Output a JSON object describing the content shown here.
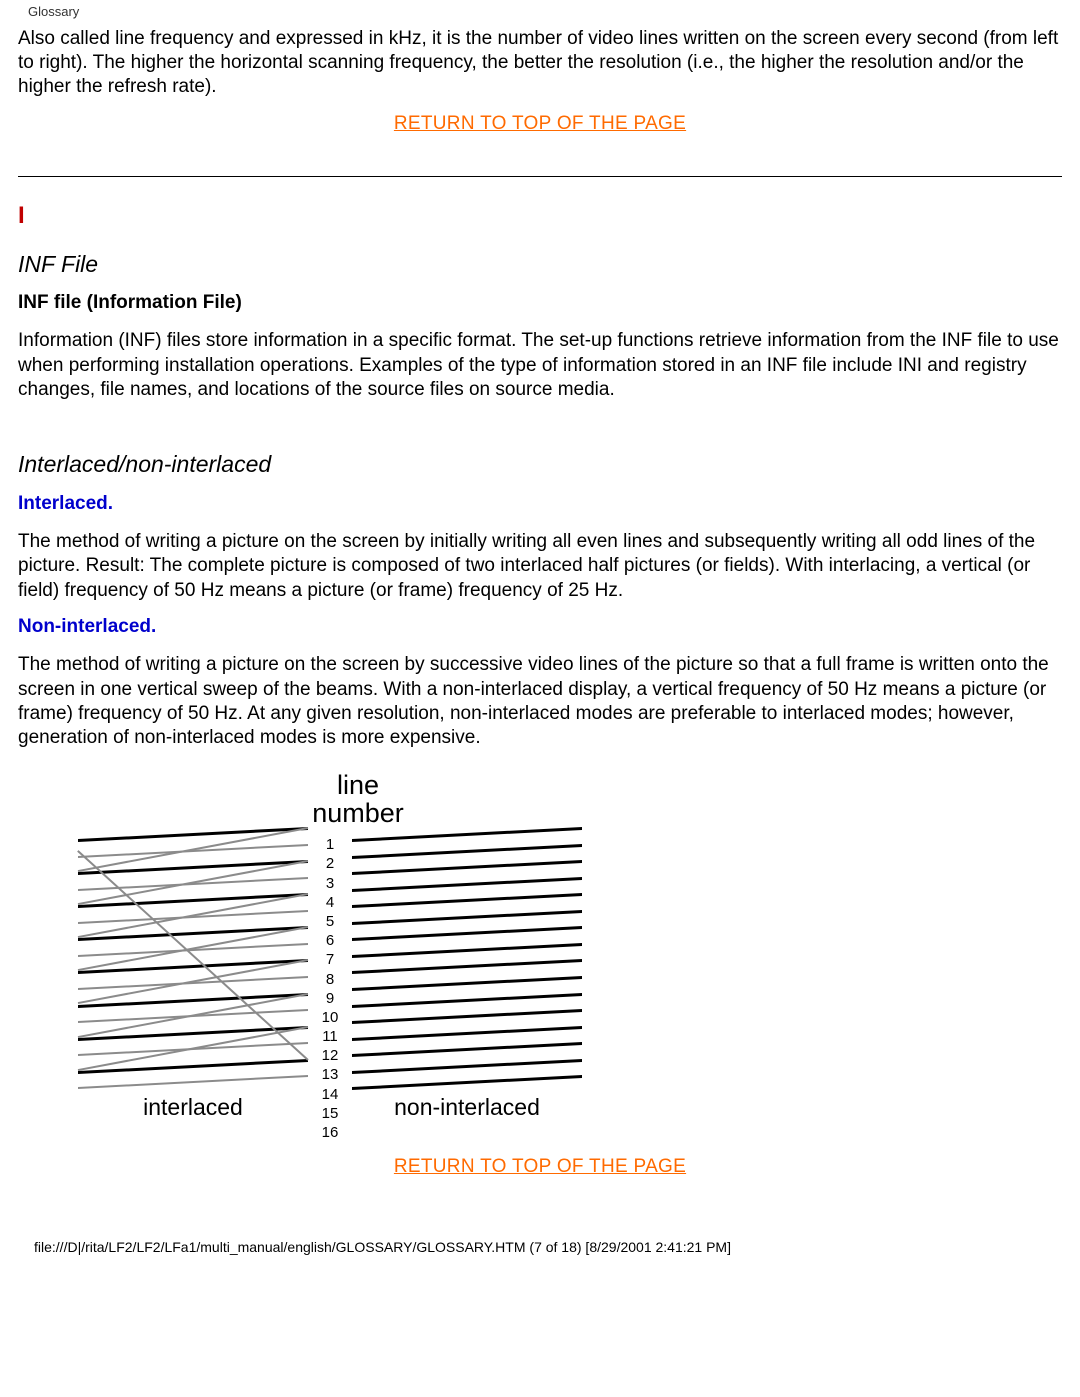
{
  "breadcrumb": "Glossary",
  "intro_para": "Also called line frequency and expressed in kHz, it is the number of video lines written on the screen every second (from left to right). The higher the horizontal scanning frequency, the better the resolution (i.e., the higher the resolution and/or the higher the refresh rate).",
  "top_link_text": "RETURN TO TOP OF THE PAGE",
  "section_letter": "I",
  "inf": {
    "title": "INF File",
    "subtitle": "INF file (Information File)",
    "para": "Information (INF) files store information in a specific format. The set-up functions retrieve information from the INF file to use when performing installation operations. Examples of the type of information stored in an INF file include INI and registry changes, file names, and locations of the source files on source media."
  },
  "interlace": {
    "title": "Interlaced/non-interlaced",
    "sub1": "Interlaced.",
    "para1": "The method of writing a picture on the screen by initially writing all even lines and subsequently writing all odd lines of the picture. Result: The complete picture is composed of two interlaced half pictures (or fields). With interlacing, a vertical (or field) frequency of 50 Hz means a picture (or frame) frequency of 25 Hz.",
    "sub2": "Non-interlaced.",
    "para2": "The method of writing a picture on the screen by successive video lines of the picture so that a full frame is written onto the screen in one vertical sweep of the beams. With a non-interlaced display, a vertical frequency of 50 Hz means a picture (or frame) frequency of 50 Hz. At any given resolution, non-interlaced modes are preferable to interlaced modes; however, generation of non-interlaced modes is more expensive."
  },
  "chart_data": {
    "type": "diagram",
    "heading_line1": "line",
    "heading_line2": "number",
    "line_numbers": [
      "1",
      "2",
      "3",
      "4",
      "5",
      "6",
      "7",
      "8",
      "9",
      "10",
      "11",
      "12",
      "13",
      "14",
      "15",
      "16"
    ],
    "panels": [
      {
        "caption": "interlaced",
        "scan_order": "odd lines first (black), then even lines (grey) as second field",
        "black_line_indices": [
          1,
          3,
          5,
          7,
          9,
          11,
          13,
          15
        ],
        "grey_line_indices": [
          2,
          4,
          6,
          8,
          10,
          12,
          14,
          16
        ]
      },
      {
        "caption": "non-interlaced",
        "scan_order": "sequential 1..16, all same field",
        "black_line_indices": [
          1,
          2,
          3,
          4,
          5,
          6,
          7,
          8,
          9,
          10,
          11,
          12,
          13,
          14,
          15,
          16
        ],
        "grey_line_indices": []
      }
    ]
  },
  "footer": "file:///D|/rita/LF2/LF2/LFa1/multi_manual/english/GLOSSARY/GLOSSARY.HTM (7 of 18) [8/29/2001 2:41:21 PM]"
}
